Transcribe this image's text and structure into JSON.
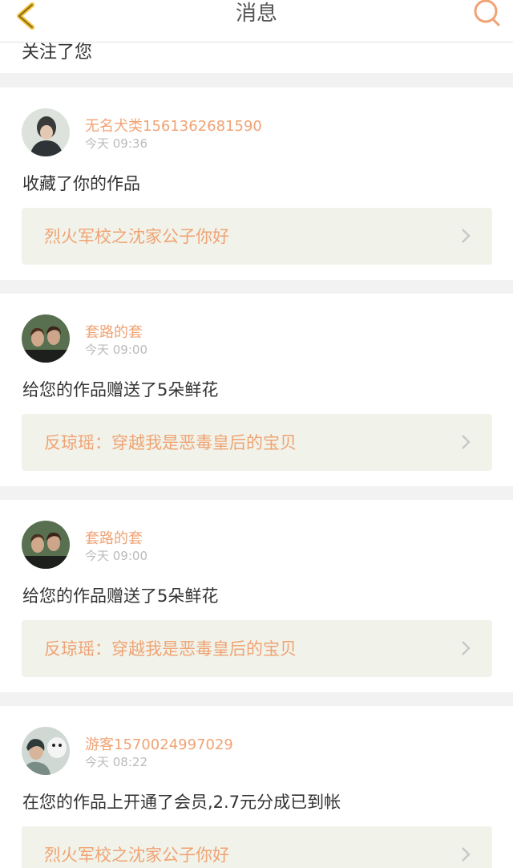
{
  "header": {
    "title": "消息"
  },
  "partial_text": "关注了您",
  "items": [
    {
      "name": "无名犬类1561362681590",
      "time": "今天 09:36",
      "action": "收藏了你的作品",
      "link": "烈火军校之沈家公子你好"
    },
    {
      "name": "套路的套",
      "time": "今天 09:00",
      "action": "给您的作品赠送了5朵鲜花",
      "link": "反琼瑶：穿越我是恶毒皇后的宝贝"
    },
    {
      "name": "套路的套",
      "time": "今天 09:00",
      "action": "给您的作品赠送了5朵鲜花",
      "link": "反琼瑶：穿越我是恶毒皇后的宝贝"
    },
    {
      "name": "游客1570024997029",
      "time": "今天 08:22",
      "action": "在您的作品上开通了会员,2.7元分成已到帐",
      "link": "烈火军校之沈家公子你好"
    }
  ],
  "colors": {
    "accent": "#f0a374",
    "link_bg": "#f1f3ea",
    "page_bg": "#f2f2f2"
  },
  "icons": {
    "back": "chevron-left-icon",
    "search": "search-icon",
    "row": "chevron-right-icon"
  }
}
